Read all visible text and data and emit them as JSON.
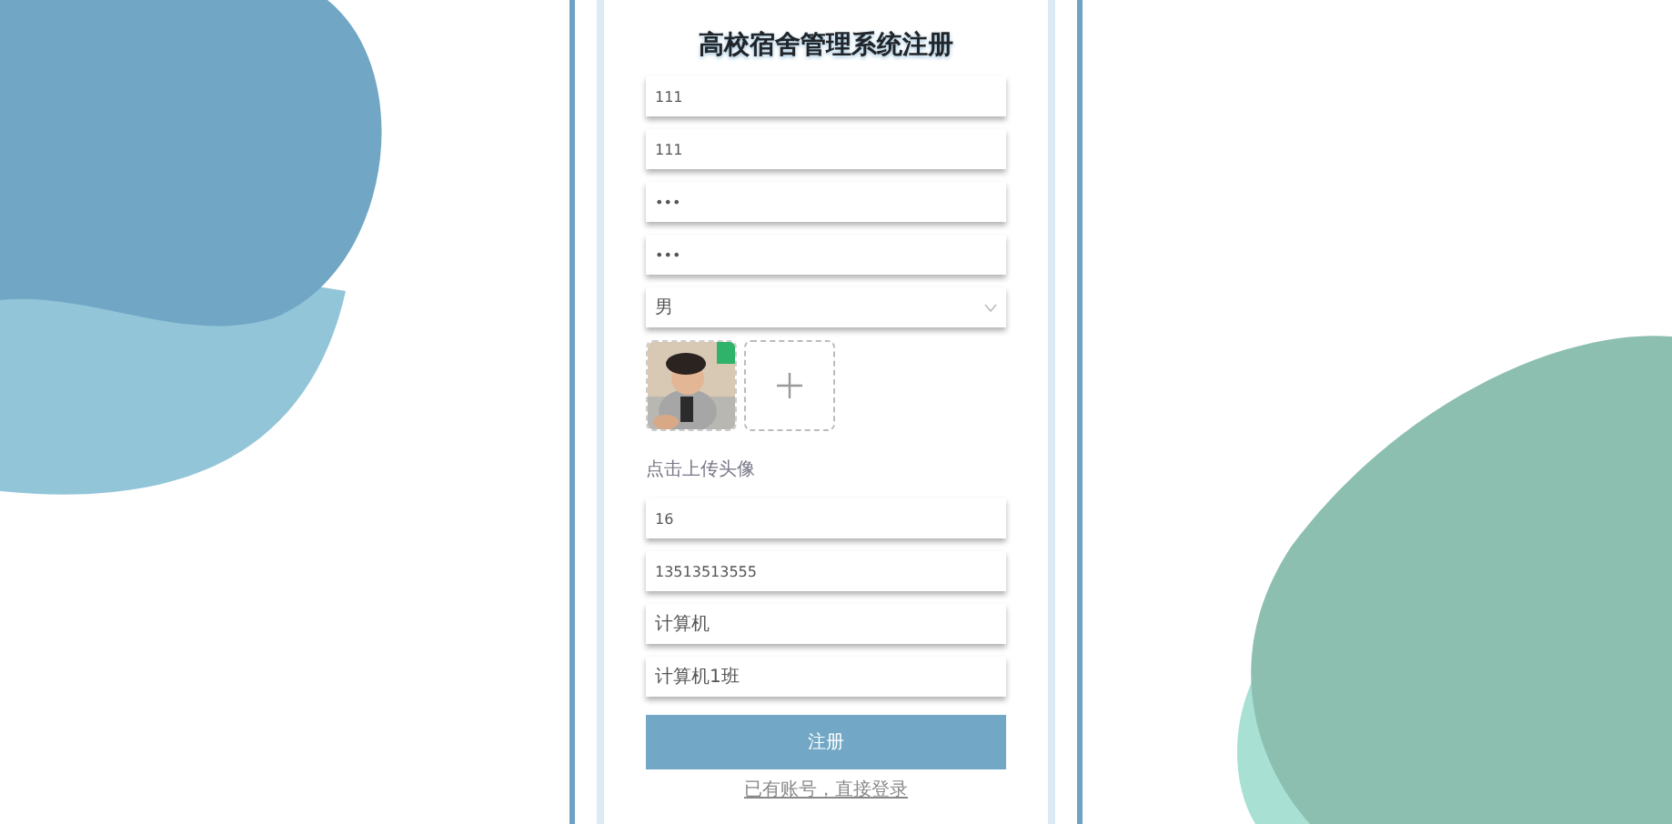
{
  "title": "高校宿舍管理系统注册",
  "fields_top": [
    {
      "kind": "text",
      "value": "111"
    },
    {
      "kind": "text",
      "value": "111"
    },
    {
      "kind": "text",
      "value": "•••"
    },
    {
      "kind": "text",
      "value": "•••"
    },
    {
      "kind": "select",
      "value": "男"
    }
  ],
  "avatar_upload": {
    "hint": "点击上传头像"
  },
  "fields_bottom": [
    {
      "kind": "text",
      "value": "16"
    },
    {
      "kind": "text",
      "value": "13513513555"
    },
    {
      "kind": "text",
      "value": "计算机"
    },
    {
      "kind": "text",
      "value": "计算机1班"
    }
  ],
  "submit_button": "注册",
  "login_link": "已有账号，直接登录"
}
